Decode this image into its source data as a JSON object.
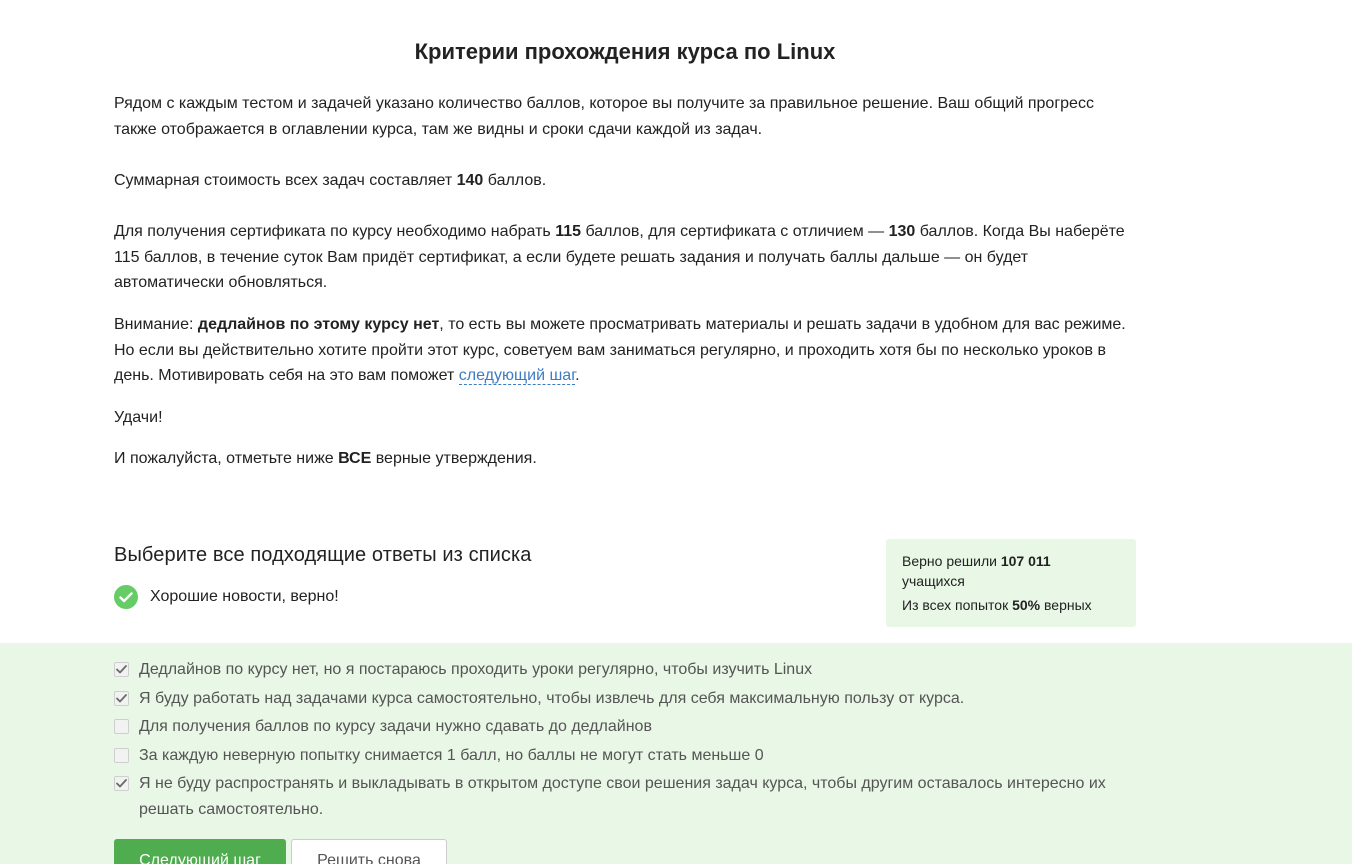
{
  "lesson": {
    "title": "Критерии прохождения курса по Linux",
    "p1": "Рядом с каждым тестом и задачей указано количество баллов, которое вы получите за правильное решение. Ваш общий прогресс также отображается в оглавлении курса, там же видны и сроки сдачи каждой из задач.",
    "p2_prefix": "Суммарная стоимость всех задач составляет ",
    "p2_bold": "140",
    "p2_suffix": " баллов.",
    "p3_a": "Для получения сертификата по курсу необходимо набрать ",
    "p3_b": "115",
    "p3_c": " баллов, для сертификата с отличием — ",
    "p3_d": "130",
    "p3_e": " баллов. Когда Вы наберёте 115 баллов, в течение суток Вам придёт сертификат, а если будете решать задания и получать баллы дальше — он будет автоматически обновляться.",
    "p4_a": "Внимание: ",
    "p4_b": "дедлайнов по этому курсу нет",
    "p4_c": ", то есть вы можете просматривать материалы и решать задачи в удобном для вас режиме. Но если вы действительно хотите пройти этот курс, советуем вам заниматься регулярно, и проходить хотя бы по несколько уроков в день. Мотивировать себя на это вам поможет ",
    "p4_link": "следующий шаг",
    "p4_d": ".",
    "p5": "Удачи!",
    "p6_a": "И пожалуйста, отметьте ниже ",
    "p6_b": "ВСЕ",
    "p6_c": " верные утверждения."
  },
  "quiz": {
    "heading": "Выберите все подходящие ответы из списка",
    "feedback": "Хорошие новости, верно!",
    "stats": {
      "solved_prefix": "Верно решили ",
      "solved_count": "107 011",
      "solved_suffix": "учащихся",
      "attempts_prefix": "Из всех попыток ",
      "attempts_percent": "50%",
      "attempts_suffix": " верных"
    },
    "options": [
      {
        "label": "Дедлайнов по курсу нет, но я постараюсь проходить уроки регулярно, чтобы изучить Linux",
        "checked": true
      },
      {
        "label": "Я буду работать над задачами курса самостоятельно, чтобы извлечь для себя максимальную пользу от курса.",
        "checked": true
      },
      {
        "label": "Для получения баллов по курсу задачи нужно сдавать до дедлайнов",
        "checked": false
      },
      {
        "label": "За каждую неверную попытку снимается 1 балл, но баллы не могут стать меньше 0",
        "checked": false
      },
      {
        "label": "Я не буду распространять и выкладывать в открытом доступе свои решения задач курса, чтобы другим оставалось интересно их решать самостоятельно.",
        "checked": true
      }
    ],
    "next_button": "Следующий шаг",
    "retry_button": "Решить снова"
  },
  "colors": {
    "accent_green": "#4fac4f",
    "success_icon": "#66cc66",
    "panel_bg": "#e9f7e6",
    "link": "#3d7bc4"
  },
  "icons": {
    "feedback": "check-circle-icon",
    "checkbox_checked": "checkmark-icon"
  }
}
